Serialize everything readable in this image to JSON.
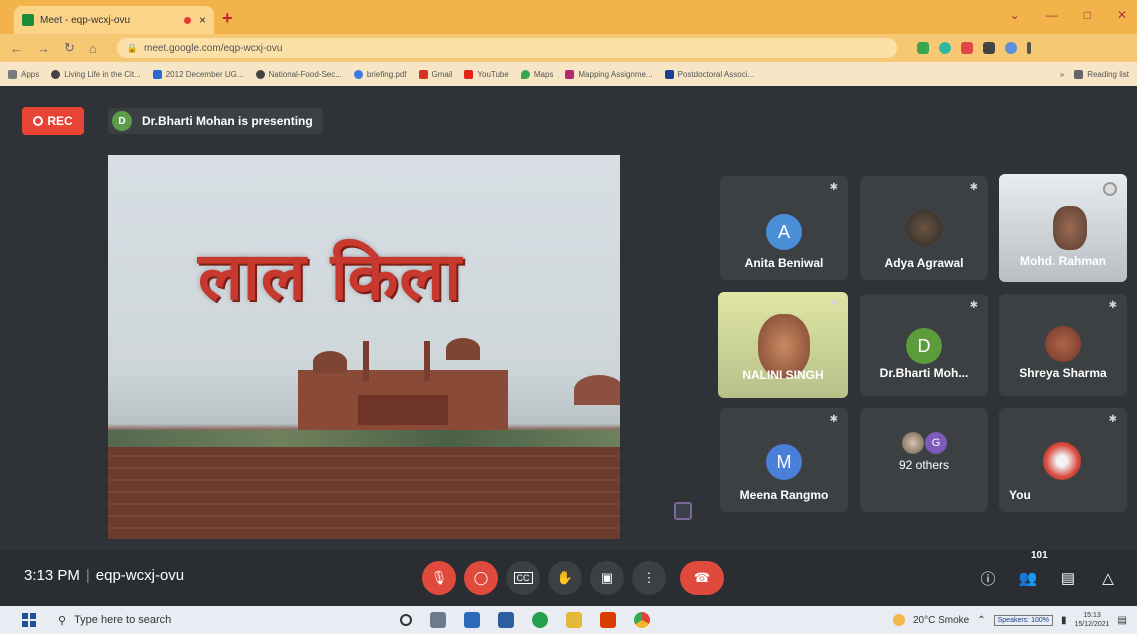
{
  "browser": {
    "tab_title": "Meet - eqp-wcxj-ovu",
    "tab_close": "×",
    "new_tab": "+",
    "url": "meet.google.com/eqp-wcxj-ovu",
    "bookmarks": [
      {
        "label": "Apps",
        "color": "#7a7a7a"
      },
      {
        "label": "Living Life in the Cit...",
        "color": "#444444"
      },
      {
        "label": "2012 December UG...",
        "color": "#2a6bd1"
      },
      {
        "label": "National-Food-Sec...",
        "color": "#444444"
      },
      {
        "label": "briefing.pdf",
        "color": "#3d7ae0"
      },
      {
        "label": "Gmail",
        "color": "#d93025"
      },
      {
        "label": "YouTube",
        "color": "#e62117"
      },
      {
        "label": "Maps",
        "color": "#34a853"
      },
      {
        "label": "Mapping Assignme...",
        "color": "#b5286e"
      },
      {
        "label": "Postdoctoral Associ...",
        "color": "#1d3f8f"
      }
    ],
    "reading_list": "Reading list"
  },
  "meet": {
    "rec_label": "REC",
    "presenter_initial": "D",
    "presenter_text": "Dr.Bharti Mohan is presenting",
    "slide_title": "लाल किला",
    "participants": [
      {
        "name": "Anita Beniwal",
        "initial": "A",
        "color": "#4a8fd8",
        "type": "initial"
      },
      {
        "name": "Adya Agrawal",
        "type": "photo"
      },
      {
        "name": "Mohd. Rahman",
        "type": "video"
      },
      {
        "name": "NALINI SINGH",
        "type": "video"
      },
      {
        "name": "Dr.Bharti Moh...",
        "initial": "D",
        "color": "#5d9c3a",
        "type": "initial"
      },
      {
        "name": "Shreya Sharma",
        "type": "photo"
      },
      {
        "name": "Meena Rangmo",
        "initial": "M",
        "color": "#4a7fd8",
        "type": "initial"
      },
      {
        "name": "92 others",
        "initial": "G",
        "color": "#7d5bbd",
        "type": "others"
      },
      {
        "name": "You",
        "type": "photo"
      }
    ],
    "time": "3:13 PM",
    "meeting_code": "eqp-wcxj-ovu",
    "participant_count": "101"
  },
  "taskbar": {
    "search_placeholder": "Type here to search",
    "weather": "20°C Smoke",
    "speakers": "Speakers: 100%",
    "time": "15:13",
    "date": "15/12/2021"
  }
}
